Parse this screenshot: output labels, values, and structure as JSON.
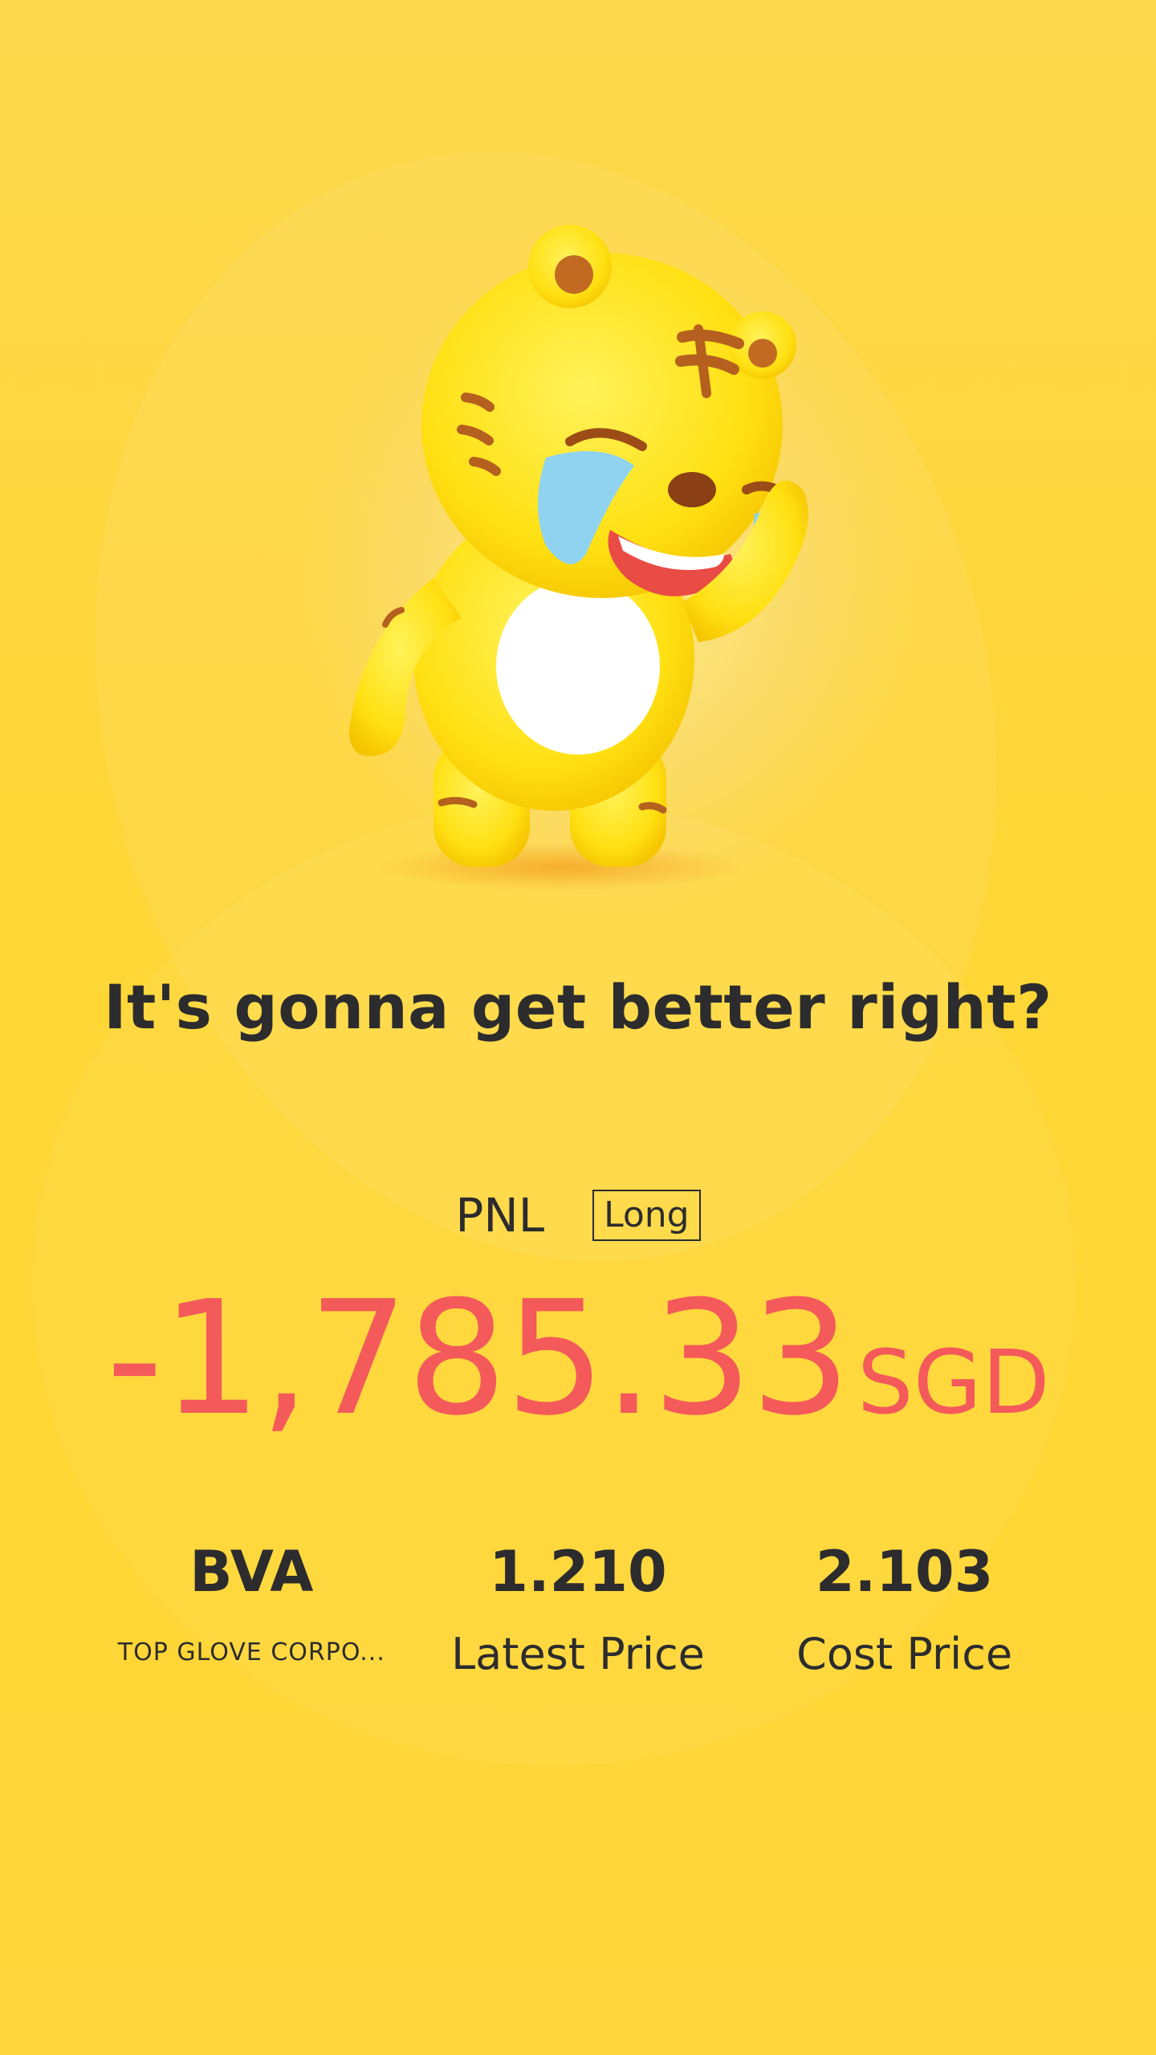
{
  "headline": "It's gonna get better right?",
  "pnl": {
    "label": "PNL",
    "position_type": "Long",
    "value": "-1,785.33",
    "currency": "SGD",
    "color": "#f45a5a"
  },
  "stats": [
    {
      "value": "BVA",
      "label": "TOP GLOVE CORPO..."
    },
    {
      "value": "1.210",
      "label": "Latest Price"
    },
    {
      "value": "2.103",
      "label": "Cost Price"
    }
  ],
  "mascot": {
    "icon": "crying-tiger-mascot-icon"
  },
  "colors": {
    "background": "#fed636",
    "text": "#2c2c2e",
    "loss": "#f45a5a"
  }
}
